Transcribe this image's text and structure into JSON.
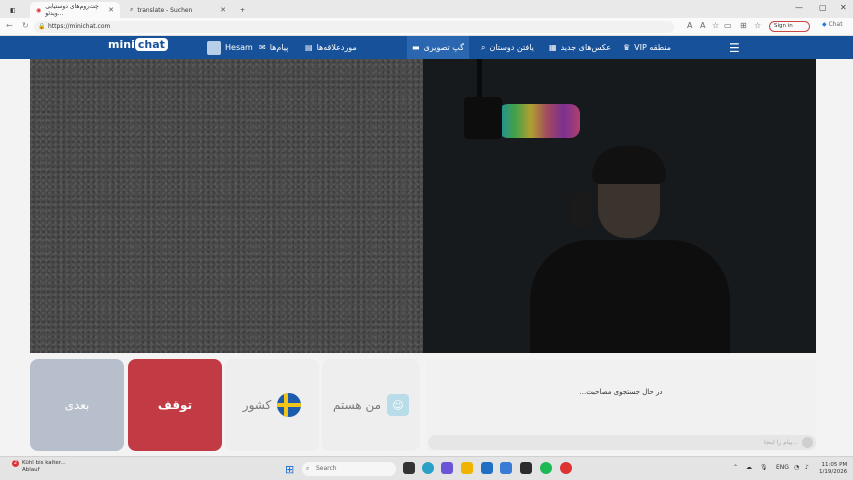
{
  "browser": {
    "tabs": [
      {
        "label": "چت‌روم‌های دوستیابی ویدئو...",
        "active": true
      },
      {
        "label": "translate - Suchen",
        "active": false
      }
    ],
    "new_tab": "+",
    "url": "https://minichat.com",
    "sign_in": "Sign in",
    "chat_label": "Chat"
  },
  "site": {
    "logo": {
      "part1": "mini",
      "part2": "chat"
    },
    "username": "Hesam",
    "nav": {
      "messages": "پیام‌ها",
      "favorites": "موردعلاقه‌ها",
      "video_chat": "گپ تصویری",
      "find_friends": "یافتن دوستان",
      "new_photos": "عکس‌های جدید",
      "vip": "VIP منطقه"
    }
  },
  "controls": {
    "next": "بعدی",
    "stop": "توقف",
    "country": "کشور",
    "me": "من هستم"
  },
  "chat": {
    "status": "...در حال جستجوی مصاحبت",
    "input_placeholder": "پیام را اینجا..."
  },
  "taskbar": {
    "notification_count": "2",
    "weather_line1": "Kühl bis kalter...",
    "weather_line2": "Ablauf",
    "search": "Search",
    "lang": "ENG",
    "time": "11:05 PM",
    "date": "1/19/2026"
  },
  "colors": {
    "header": "#17519a",
    "stop_button": "#c23b44",
    "next_button": "#b8bfcc"
  }
}
